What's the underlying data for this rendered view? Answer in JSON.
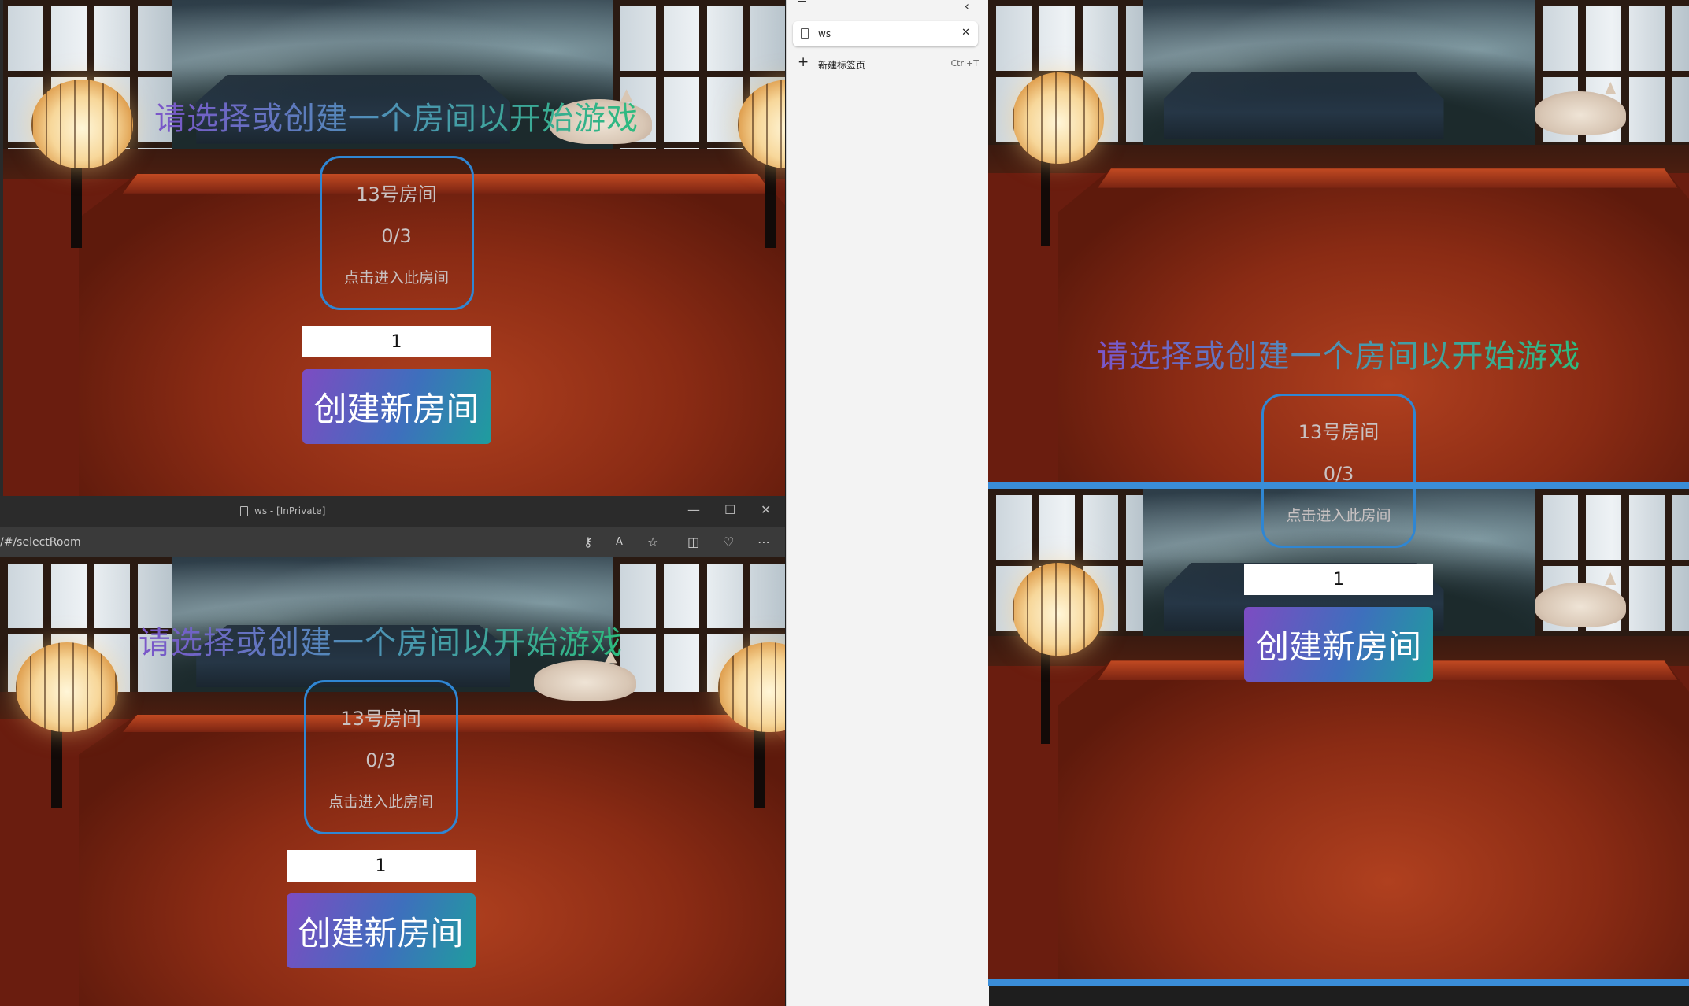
{
  "game": {
    "prompt": "请选择或创建一个房间以开始游戏",
    "room": {
      "name": "13号房间",
      "count": "0/3",
      "enter": "点击进入此房间"
    },
    "input_value": "1",
    "create_label": "创建新房间"
  },
  "inprivate_window": {
    "title": "ws - [InPrivate]",
    "url": "/#/selectRoom",
    "controls": {
      "minimize": "—",
      "maximize": "☐",
      "close": "✕"
    },
    "toolbar_icons": [
      "key-icon",
      "read-aloud-icon",
      "favorite-star-icon",
      "split-screen-icon",
      "heart-pulse-icon",
      "more-icon"
    ]
  },
  "tab_sidebar": {
    "tabs": [
      {
        "label": "ws"
      }
    ],
    "new_tab": {
      "label": "新建标签页",
      "shortcut": "Ctrl+T"
    }
  },
  "colors": {
    "accent_border": "#2f86d3",
    "divider_blue": "#3a8dd8",
    "button_start": "#7d4cc2",
    "button_end": "#1f9d9e"
  }
}
